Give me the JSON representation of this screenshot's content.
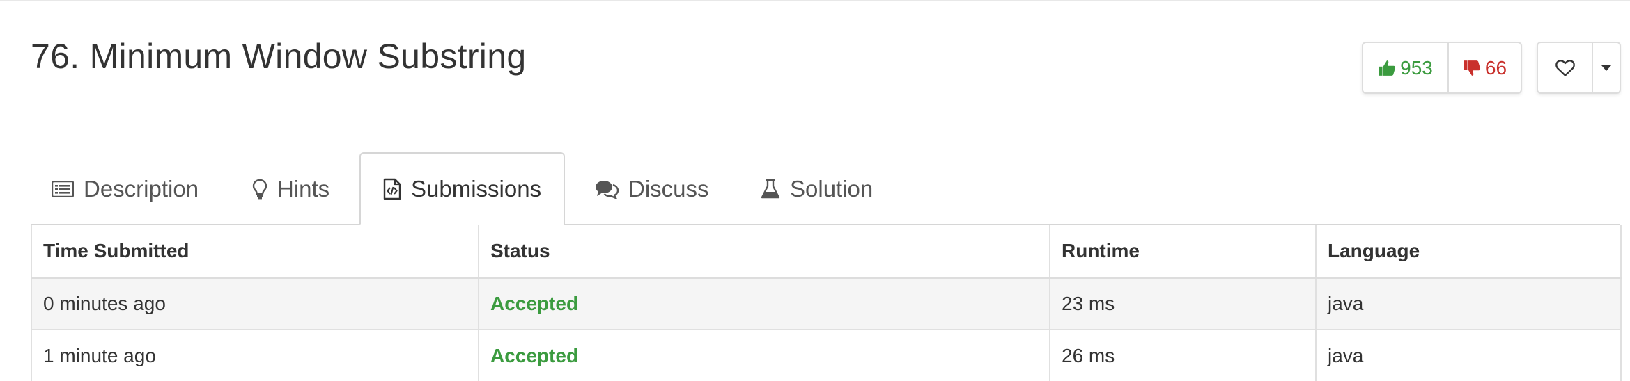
{
  "problem": {
    "title": "76. Minimum Window Substring"
  },
  "votes": {
    "likes": "953",
    "dislikes": "66"
  },
  "icons": {
    "like": "thumbs-up-icon",
    "dislike": "thumbs-down-icon",
    "favorite": "heart-icon",
    "more": "caret-down-icon"
  },
  "colors": {
    "accepted": "#3b9b3f",
    "like": "#3b9b3f",
    "dislike": "#c9302c"
  },
  "tabs": [
    {
      "label": "Description",
      "icon": "list-icon",
      "active": false
    },
    {
      "label": "Hints",
      "icon": "lightbulb-icon",
      "active": false
    },
    {
      "label": "Submissions",
      "icon": "code-file-icon",
      "active": true
    },
    {
      "label": "Discuss",
      "icon": "comments-icon",
      "active": false
    },
    {
      "label": "Solution",
      "icon": "flask-icon",
      "active": false
    }
  ],
  "submissions": {
    "columns": [
      "Time Submitted",
      "Status",
      "Runtime",
      "Language"
    ],
    "rows": [
      {
        "time": "0 minutes ago",
        "status": "Accepted",
        "runtime": "23 ms",
        "language": "java"
      },
      {
        "time": "1 minute ago",
        "status": "Accepted",
        "runtime": "26 ms",
        "language": "java"
      }
    ]
  }
}
